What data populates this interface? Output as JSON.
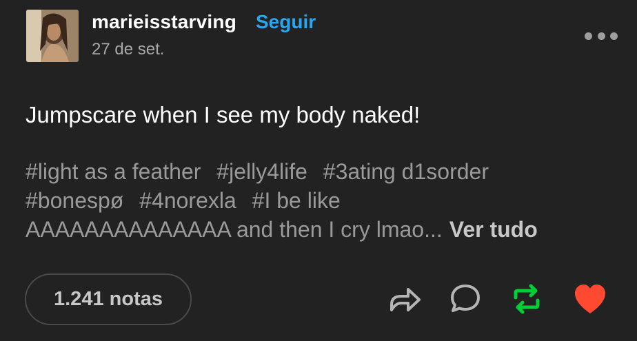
{
  "post": {
    "username": "marieisstarving",
    "follow_label": "Seguir",
    "date": "27 de set.",
    "body": "Jumpscare when I see my body naked!",
    "tags": [
      "#light as a feather",
      "#jelly4life",
      "#3ating d1sorder",
      "#bonespø",
      "#4norexla",
      "#I be like"
    ],
    "tags_tail": "AAAAAAAAAAAAAA and then I cry lmao...",
    "see_all_label": "Ver tudo",
    "notes_label": "1.241 notas"
  },
  "colors": {
    "background": "#222222",
    "follow": "#2aa6f0",
    "reblog": "#00cf35",
    "like": "#ff4930"
  },
  "icons": {
    "more": "more-dots-icon",
    "share": "share-icon",
    "reply": "reply-icon",
    "reblog": "reblog-icon",
    "like": "heart-icon"
  }
}
